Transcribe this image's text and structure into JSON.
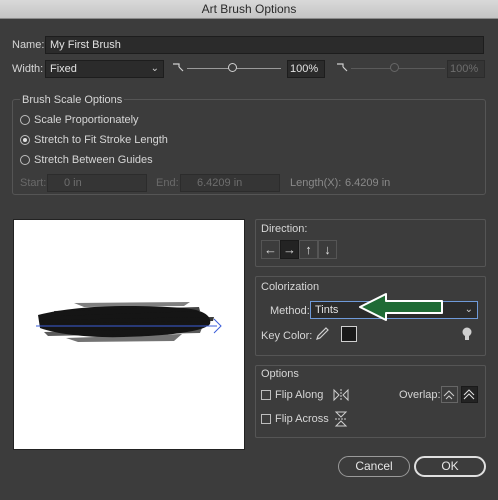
{
  "window": {
    "title": "Art Brush Options"
  },
  "name": {
    "label": "Name:",
    "value": "My First Brush"
  },
  "width": {
    "label": "Width:",
    "select_value": "Fixed",
    "percent_value": "100%",
    "percent_value_disabled": "100%",
    "slider_level": 0.55
  },
  "brush_scale": {
    "title": "Brush Scale Options",
    "options": [
      {
        "label": "Scale Proportionately",
        "checked": false
      },
      {
        "label": "Stretch to Fit Stroke Length",
        "checked": true
      },
      {
        "label": "Stretch Between Guides",
        "checked": false
      }
    ],
    "start_label": "Start:",
    "start_value": "0 in",
    "end_label": "End:",
    "end_value": "6.4209 in",
    "length_label": "Length(X):",
    "length_value": "6.4209 in"
  },
  "direction": {
    "title": "Direction:",
    "buttons": [
      "←",
      "→",
      "↑",
      "↓"
    ],
    "active_index": 1
  },
  "colorization": {
    "title": "Colorization",
    "method_label": "Method:",
    "method_value": "Tints",
    "key_color_label": "Key Color:",
    "key_color": "#1a1a1a"
  },
  "options": {
    "title": "Options",
    "flip_along": "Flip Along",
    "flip_across": "Flip Across",
    "overlap_label": "Overlap:"
  },
  "buttons": {
    "cancel": "Cancel",
    "ok": "OK"
  },
  "colors": {
    "arrow": "#1f6b35",
    "stroke_guide": "#3a5dd9",
    "accent_border": "#6f9ad9"
  }
}
